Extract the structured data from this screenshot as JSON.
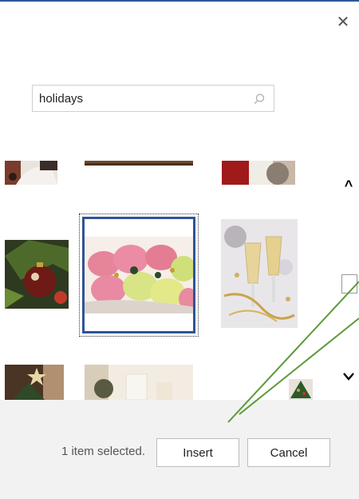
{
  "dialog": {
    "close_icon": "close-icon",
    "accent": "#2b579a"
  },
  "search": {
    "value": "holidays",
    "icon": "search-icon"
  },
  "results": {
    "images": [
      {
        "name": "snowman-image"
      },
      {
        "name": "wood-plank-image"
      },
      {
        "name": "santa-hat-image"
      },
      {
        "name": "christmas-ornament-image"
      },
      {
        "name": "macarons-image",
        "selected": true
      },
      {
        "name": "champagne-glasses-image"
      },
      {
        "name": "star-tree-image"
      },
      {
        "name": "candles-image"
      },
      {
        "name": "small-tree-image"
      }
    ]
  },
  "scrollbar": {
    "up_icon": "chevron-up-icon",
    "down_icon": "chevron-down-icon"
  },
  "footer": {
    "status": "1 item selected.",
    "insert_label": "Insert",
    "cancel_label": "Cancel"
  },
  "annotation": {
    "line_color": "#5a9a3a"
  }
}
